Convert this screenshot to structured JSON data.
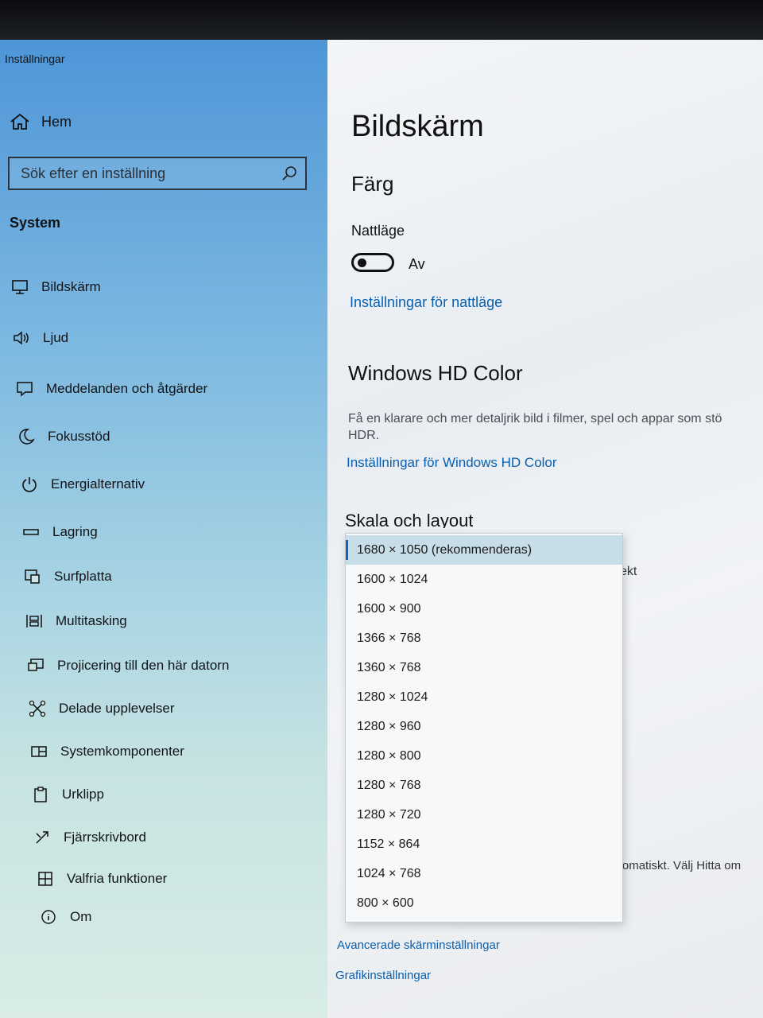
{
  "window": {
    "title": "Inställningar"
  },
  "sidebar": {
    "home_label": "Hem",
    "search_placeholder": "Sök efter en inställning",
    "section_label": "System",
    "items": [
      {
        "label": "Bildskärm",
        "icon": "monitor-icon"
      },
      {
        "label": "Ljud",
        "icon": "speaker-icon"
      },
      {
        "label": "Meddelanden och åtgärder",
        "icon": "notification-icon"
      },
      {
        "label": "Fokusstöd",
        "icon": "moon-icon"
      },
      {
        "label": "Energialternativ",
        "icon": "power-icon"
      },
      {
        "label": "Lagring",
        "icon": "storage-icon"
      },
      {
        "label": "Surfplatta",
        "icon": "tablet-icon"
      },
      {
        "label": "Multitasking",
        "icon": "multitasking-icon"
      },
      {
        "label": "Projicering till den här datorn",
        "icon": "projection-icon"
      },
      {
        "label": "Delade upplevelser",
        "icon": "shared-experiences-icon"
      },
      {
        "label": "Systemkomponenter",
        "icon": "components-icon"
      },
      {
        "label": "Urklipp",
        "icon": "clipboard-icon"
      },
      {
        "label": "Fjärrskrivbord",
        "icon": "remote-desktop-icon"
      },
      {
        "label": "Valfria funktioner",
        "icon": "optional-features-icon"
      },
      {
        "label": "Om",
        "icon": "info-icon"
      }
    ]
  },
  "main": {
    "title": "Bildskärm",
    "color_heading": "Färg",
    "night_light_label": "Nattläge",
    "night_light_state": "Av",
    "night_light_link": "Inställningar för nattläge",
    "hd_heading": "Windows HD Color",
    "hd_description_line1": "Få en klarare och mer detaljrik bild i filmer, spel och appar som stö",
    "hd_description_line2": "HDR.",
    "hd_link": "Inställningar för Windows HD Color",
    "scale_heading": "Skala och layout",
    "partial_text_right": "ekt",
    "partial_text_bottom": "automatiskt. Välj Hitta om",
    "advanced_link": "Avancerade skärminställningar",
    "graphics_link": "Grafikinställningar"
  },
  "resolution_dropdown": {
    "selected": "1680 × 1050 (rekommenderas)",
    "options": [
      "1680 × 1050 (rekommenderas)",
      "1600 × 1024",
      "1600 × 900",
      "1366 × 768",
      "1360 × 768",
      "1280 × 1024",
      "1280 × 960",
      "1280 × 800",
      "1280 × 768",
      "1280 × 720",
      "1152 × 864",
      "1024 × 768",
      "800 × 600"
    ]
  },
  "colors": {
    "accent": "#0a66b8",
    "link": "#0a5fae",
    "selected_option_bg": "#c7dde8"
  }
}
